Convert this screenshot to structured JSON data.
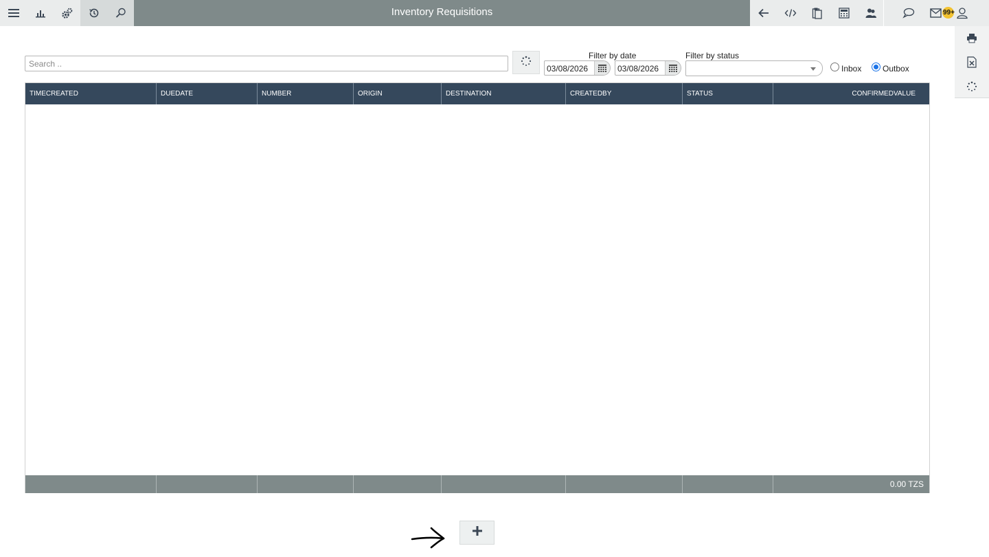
{
  "app": {
    "title": "Inventory Requisitions"
  },
  "topbar": {
    "left_icons": [
      "menu-icon",
      "bar-chart-icon",
      "gears-icon",
      "history-icon",
      "search-icon"
    ],
    "right_icons": [
      "back-arrow-icon",
      "code-icon",
      "clipboard-icon",
      "calculator-icon",
      "users-icon",
      "chat-icon",
      "mail-icon",
      "user-icon"
    ],
    "notification_count": "99+"
  },
  "side_toolbar": {
    "icons": [
      "printer-icon",
      "excel-export-icon",
      "refresh-icon"
    ]
  },
  "filters": {
    "search_placeholder": "Search ..",
    "date_label": "Filter by date",
    "date_from": "03/08/2026",
    "date_to": "03/08/2026",
    "status_label": "Filter by status",
    "status_value": "",
    "radio_options": [
      {
        "label": "Inbox",
        "checked": false
      },
      {
        "label": "Outbox",
        "checked": true
      }
    ]
  },
  "grid": {
    "columns": [
      "TIMECREATED",
      "DUEDATE",
      "NUMBER",
      "ORIGIN",
      "DESTINATION",
      "CREATEDBY",
      "STATUS",
      "CONFIRMEDVALUE"
    ],
    "rows": [],
    "footer_total": "0.00 TZS"
  },
  "actions": {
    "add_icon": "plus-icon"
  },
  "colors": {
    "topbar": "#7f8a8a",
    "header": "#35485c",
    "footer": "#7f8a8a",
    "badge": "#f2c230",
    "radio_selected": "#1a73e8"
  }
}
